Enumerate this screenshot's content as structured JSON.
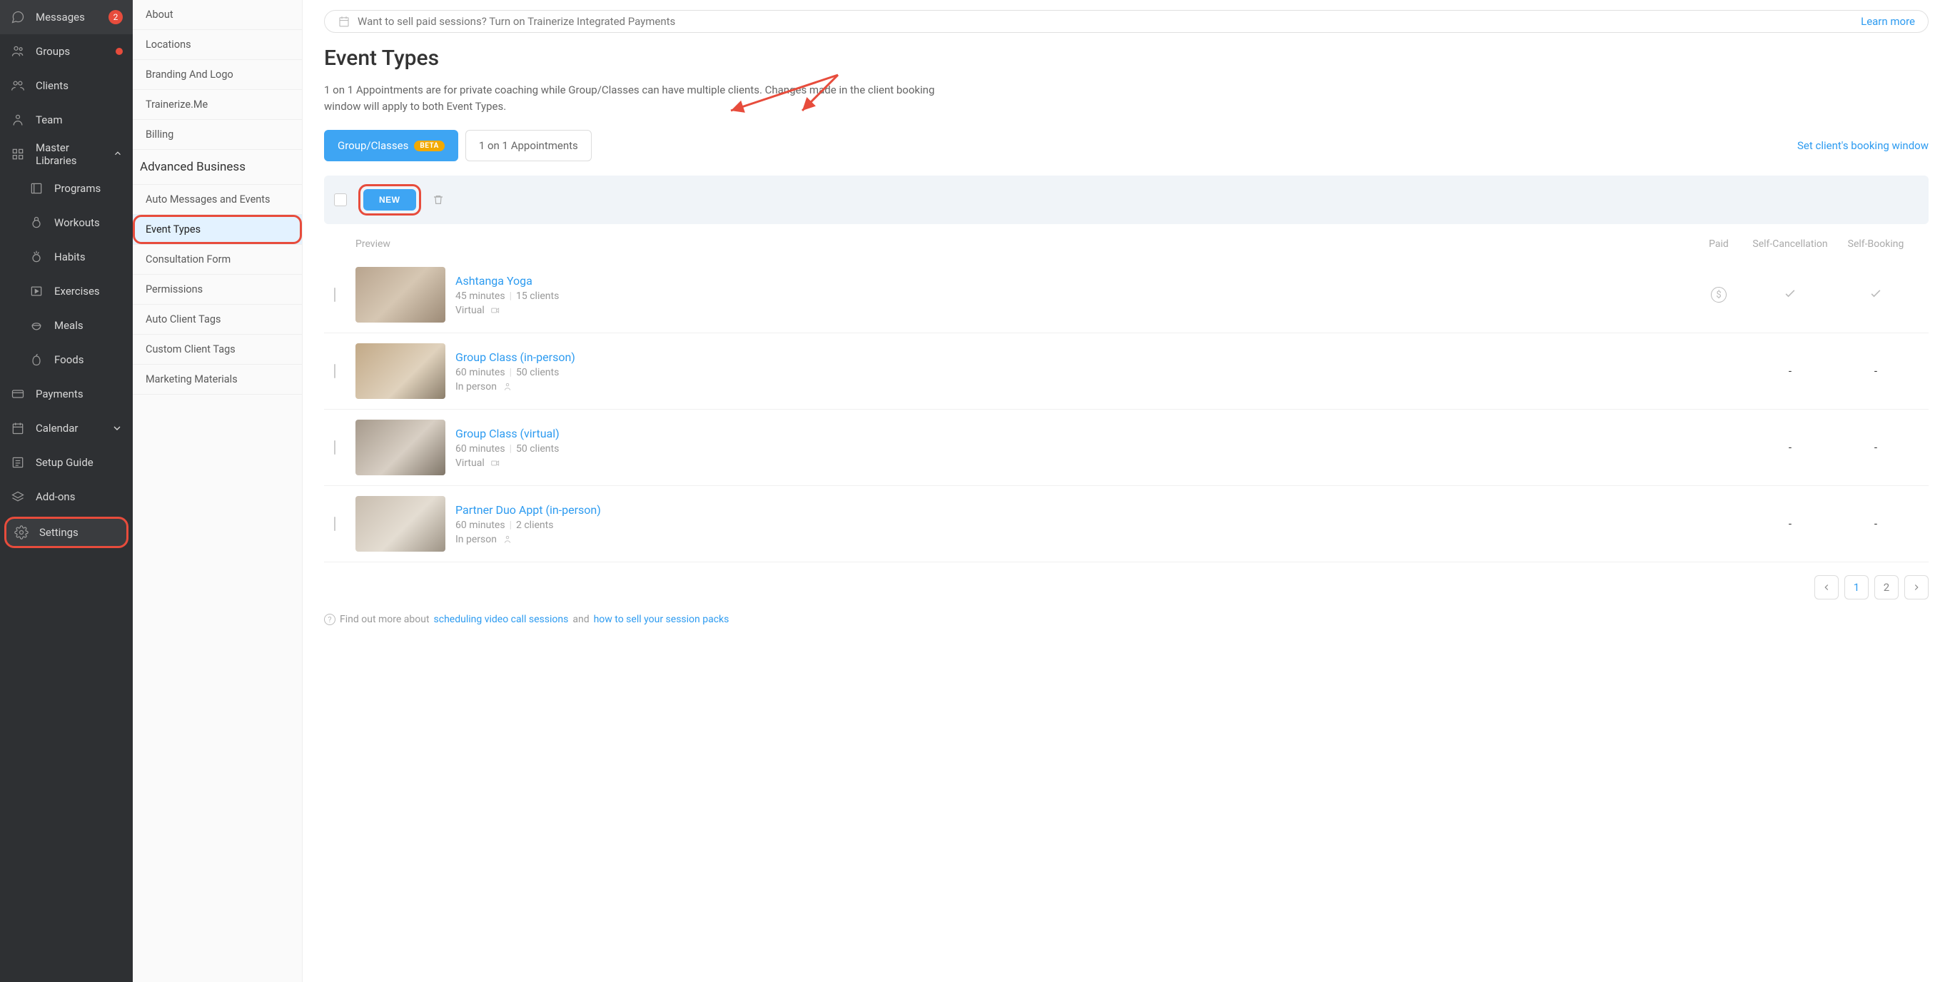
{
  "sidebar": {
    "items": [
      {
        "label": "Messages",
        "badge_num": "2"
      },
      {
        "label": "Groups",
        "badge_dot": true
      },
      {
        "label": "Clients"
      },
      {
        "label": "Team"
      },
      {
        "label": "Master Libraries",
        "expanded": true
      },
      {
        "label": "Programs",
        "sub": true
      },
      {
        "label": "Workouts",
        "sub": true
      },
      {
        "label": "Habits",
        "sub": true
      },
      {
        "label": "Exercises",
        "sub": true
      },
      {
        "label": "Meals",
        "sub": true
      },
      {
        "label": "Foods",
        "sub": true
      },
      {
        "label": "Payments"
      },
      {
        "label": "Calendar",
        "chevron": true
      },
      {
        "label": "Setup Guide"
      },
      {
        "label": "Add-ons"
      },
      {
        "label": "Settings",
        "highlight": true
      }
    ]
  },
  "settings_menu": {
    "section1": [
      {
        "label": "About"
      },
      {
        "label": "Locations"
      },
      {
        "label": "Branding And Logo"
      },
      {
        "label": "Trainerize.Me"
      },
      {
        "label": "Billing"
      }
    ],
    "section2_header": "Advanced Business",
    "section2": [
      {
        "label": "Auto Messages and Events"
      },
      {
        "label": "Event Types",
        "active": true,
        "highlight": true
      },
      {
        "label": "Consultation Form"
      },
      {
        "label": "Permissions"
      },
      {
        "label": "Auto Client Tags"
      },
      {
        "label": "Custom Client Tags"
      },
      {
        "label": "Marketing Materials"
      }
    ]
  },
  "banner": {
    "text": "Want to sell paid sessions? Turn on Trainerize Integrated Payments",
    "learn_more": "Learn more"
  },
  "page": {
    "title": "Event Types",
    "desc": "1 on 1 Appointments are for private coaching while Group/Classes can have multiple clients. Changes made in the client booking window will apply to both Event Types."
  },
  "tabs": {
    "group": "Group/Classes",
    "group_badge": "BETA",
    "oneonone": "1 on 1 Appointments",
    "book_link": "Set client's booking window"
  },
  "toolbar": {
    "new_label": "NEW"
  },
  "table": {
    "headers": {
      "preview": "Preview",
      "paid": "Paid",
      "self_cancel": "Self-Cancellation",
      "self_book": "Self-Booking"
    },
    "rows": [
      {
        "title": "Ashtanga Yoga",
        "duration": "45 minutes",
        "clients": "15 clients",
        "location": "Virtual",
        "loc_icon": "video",
        "paid": "dollar",
        "self_cancel": "check",
        "self_book": "check"
      },
      {
        "title": "Group Class (in-person)",
        "duration": "60 minutes",
        "clients": "50 clients",
        "location": "In person",
        "loc_icon": "person",
        "paid": "",
        "self_cancel": "-",
        "self_book": "-"
      },
      {
        "title": "Group Class (virtual)",
        "duration": "60 minutes",
        "clients": "50 clients",
        "location": "Virtual",
        "loc_icon": "video",
        "paid": "",
        "self_cancel": "-",
        "self_book": "-"
      },
      {
        "title": "Partner Duo Appt (in-person)",
        "duration": "60 minutes",
        "clients": "2 clients",
        "location": "In person",
        "loc_icon": "person",
        "paid": "",
        "self_cancel": "-",
        "self_book": "-"
      }
    ]
  },
  "pagination": {
    "pages": [
      "1",
      "2"
    ],
    "active": "1"
  },
  "footnote": {
    "prefix": "Find out more about ",
    "link1": "scheduling video call sessions",
    "mid": " and ",
    "link2": "how to sell your session packs"
  }
}
